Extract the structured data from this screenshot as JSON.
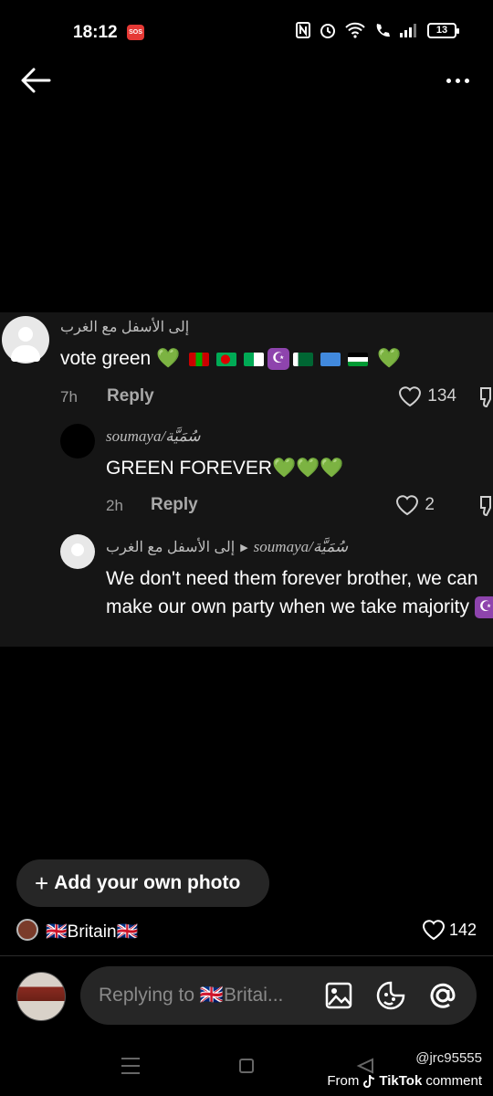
{
  "status_bar": {
    "time": "18:12",
    "sos": "SOS",
    "battery": "13",
    "icons": [
      "nfc-icon",
      "alarm-icon",
      "wifi-icon",
      "volte-icon",
      "signal-icon",
      "battery-icon"
    ]
  },
  "nav": {
    "back_icon": "arrow-left-icon",
    "menu_icon": "more-horizontal-icon"
  },
  "comments": [
    {
      "username": "إلى الأسفل مع الغرب",
      "text": "vote green",
      "age": "7h",
      "reply_label": "Reply",
      "likes": "134"
    },
    {
      "username": "soumaya/سُمَيَّة",
      "text": "GREEN FOREVER",
      "age": "2h",
      "reply_label": "Reply",
      "likes": "2"
    },
    {
      "username": "إلى الأسفل مع الغرب",
      "reply_to": "soumaya/سُمَيَّة",
      "text": "We don't need them forever brother, we can make our own party when we take majority"
    }
  ],
  "emoji": {
    "green_heart": "💚",
    "crescent": "☪"
  },
  "add_photo": {
    "plus": "+",
    "label": "Add your own photo"
  },
  "post": {
    "author": "🇬🇧Britain🇬🇧",
    "likes": "142"
  },
  "reply_bar": {
    "placeholder": "Replying to 🇬🇧Britai..."
  },
  "watermark": {
    "handle": "@jrc95555",
    "from": "From",
    "brand": "TikTok",
    "suffix": "comment"
  },
  "colors": {
    "background": "#000000",
    "panel": "#151515",
    "green_heart": "#3ad43a",
    "crescent_bg": "#8e44ad",
    "sos": "#e53935"
  }
}
